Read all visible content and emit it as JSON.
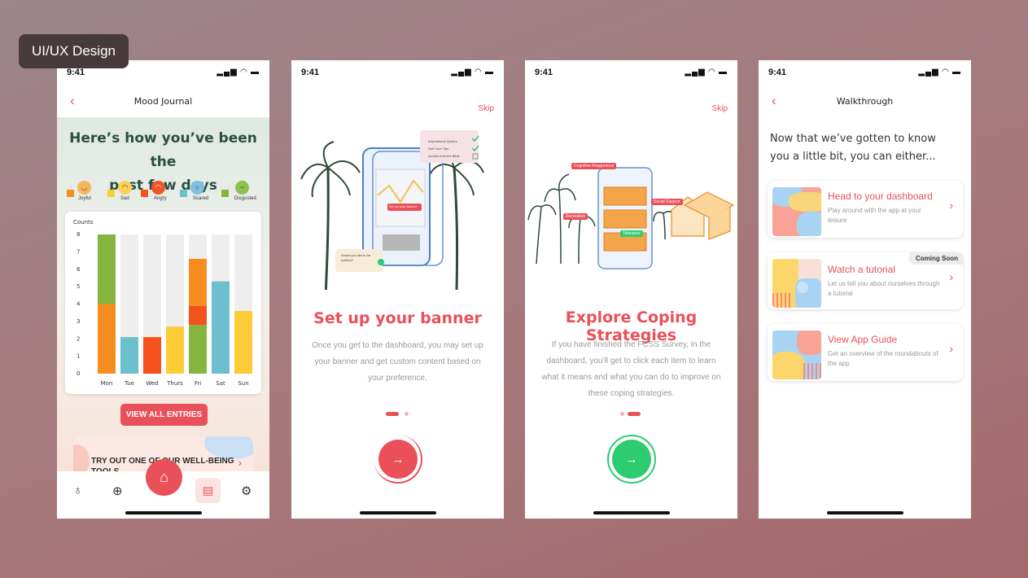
{
  "tag": "UI/UX Design",
  "status": {
    "time": "9:41"
  },
  "journal": {
    "title": "Mood Journal",
    "heading_line1": "Here’s how you’ve been the",
    "heading_line2": "past few days",
    "legend": [
      {
        "label": "Joyful",
        "color": "#f68e1f"
      },
      {
        "label": "Sad",
        "color": "#fccb35"
      },
      {
        "label": "Angry",
        "color": "#f4521c"
      },
      {
        "label": "Scared",
        "color": "#6cbfcd"
      },
      {
        "label": "Disgusted",
        "color": "#86b53f"
      }
    ],
    "view_all": "VIEW ALL ENTRIES",
    "try_out": "TRY OUT ONE OF OUR WELL-BEING TOOLS"
  },
  "chart_data": {
    "type": "bar",
    "ylabel": "Counts",
    "ylim": [
      0,
      8
    ],
    "yticks": [
      "0",
      "1",
      "2",
      "3",
      "4",
      "5",
      "6",
      "7",
      "8"
    ],
    "categories": [
      "Mon",
      "Tue",
      "Wed",
      "Thurs",
      "Fri",
      "Sat",
      "Sun"
    ],
    "stacks": [
      [
        {
          "mood": "Joyful",
          "value": 4
        },
        {
          "mood": "Disgusted",
          "value": 4
        }
      ],
      [
        {
          "mood": "Scared",
          "value": 2.1
        }
      ],
      [
        {
          "mood": "Angry",
          "value": 2.1
        }
      ],
      [
        {
          "mood": "Sad",
          "value": 2.7
        }
      ],
      [
        {
          "mood": "Disgusted",
          "value": 2.8
        },
        {
          "mood": "Angry",
          "value": 1.1
        },
        {
          "mood": "Joyful",
          "value": 2.7
        }
      ],
      [
        {
          "mood": "Scared",
          "value": 5.3
        }
      ],
      [
        {
          "mood": "Sad",
          "value": 3.6
        }
      ]
    ],
    "max": 8
  },
  "banner": {
    "skip": "Skip",
    "title": "Set up your banner",
    "body": "Once you get to the dashboard, you may set up your banner and get custom content based on your preference.",
    "illus_list": [
      "Inspirational Quotes",
      "Self Care Tips",
      "Quotes from the Bible"
    ],
    "illus_chip": "Set up your banner",
    "illus_bubble": "Would you like to be notified?"
  },
  "coping": {
    "skip": "Skip",
    "title": "Explore Coping Strategies",
    "body": "If you have finished the FCSS Survey, in the dashboard, you’ll get to click each item to learn what it means and what you can do to improve on these coping strategies.",
    "illus_tags": [
      "Cognitive Reappraisal",
      "Social Support",
      "Recreation",
      "Tolerance"
    ]
  },
  "walkthrough": {
    "title": "Walkthrough",
    "intro": "Now that we’ve gotten to know you a little bit, you can either...",
    "options": [
      {
        "title": "Head to your dashboard",
        "desc": "Play around with the app at your leisure"
      },
      {
        "title": "Watch a tutorial",
        "desc": "Let us tell you about ourselves through a tutorial",
        "badge": "Coming Soon"
      },
      {
        "title": "View App Guide",
        "desc": "Get an overview of the roundabouts of the app"
      }
    ]
  }
}
